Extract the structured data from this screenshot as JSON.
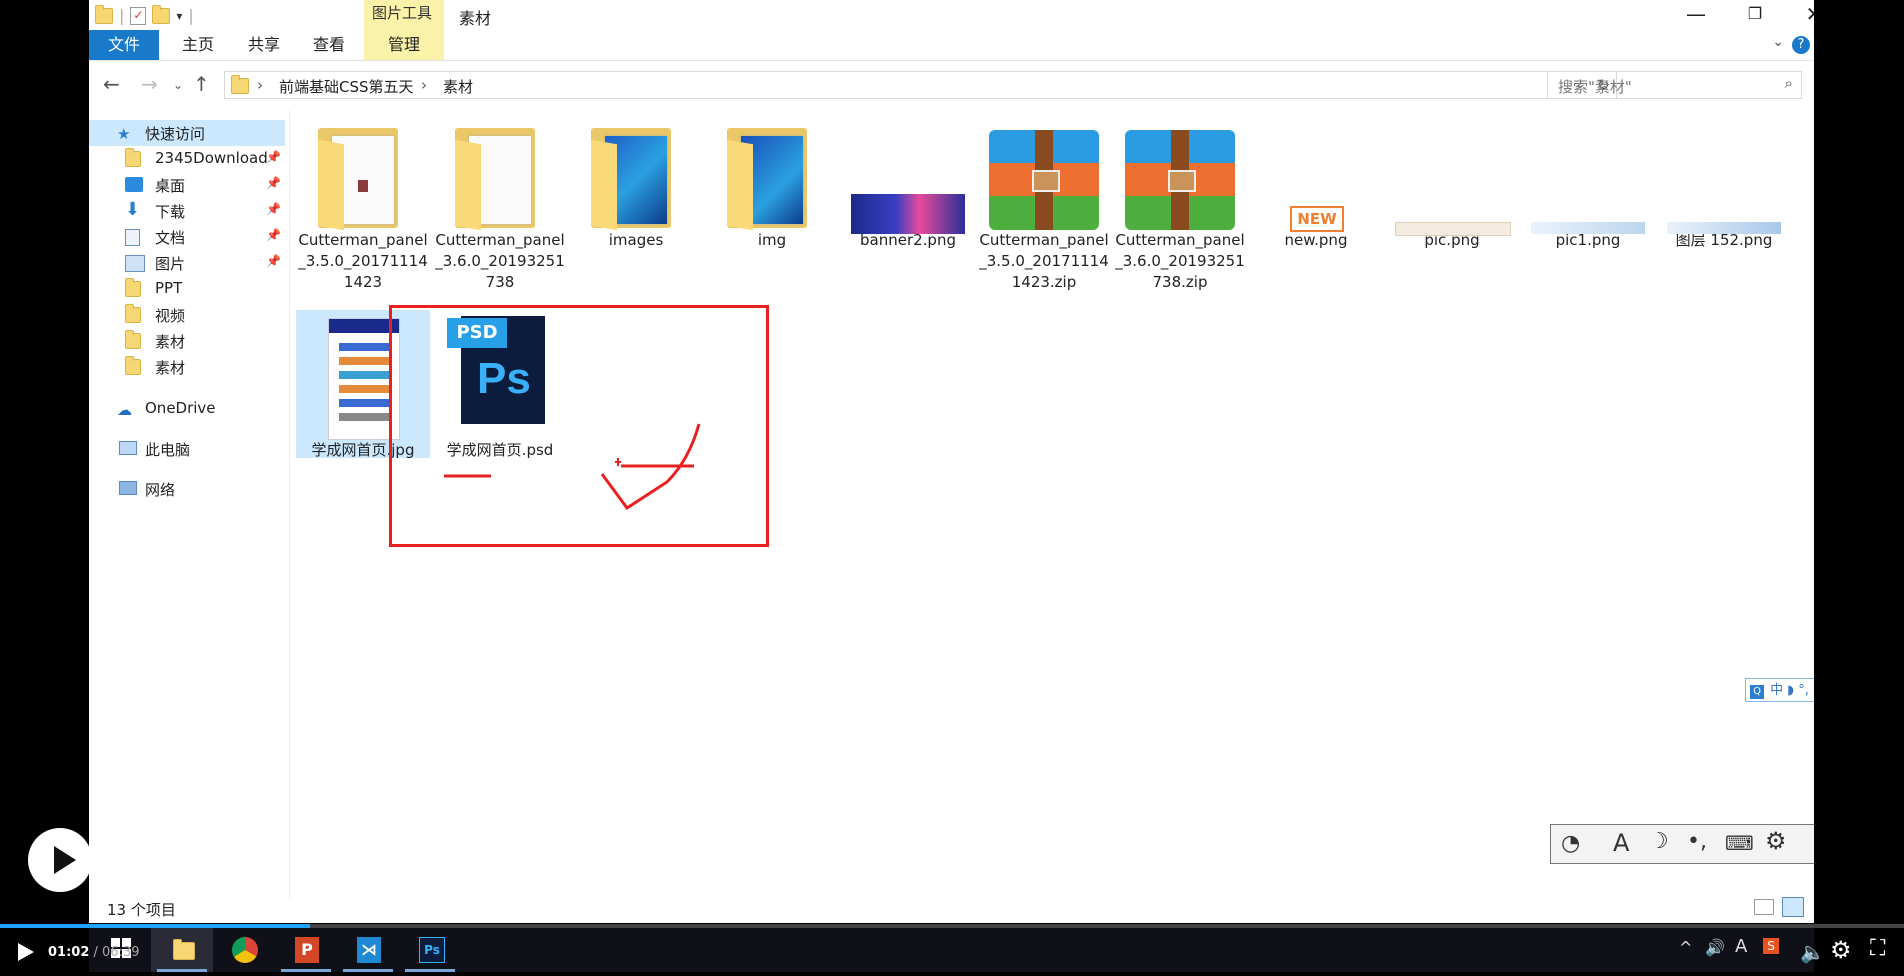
{
  "window": {
    "title": "素材",
    "contextual_tab_group": "图片工具",
    "controls": {
      "minimize": "—",
      "restore": "❐",
      "close": "✕"
    }
  },
  "ribbon": {
    "tabs": [
      "文件",
      "主页",
      "共享",
      "查看",
      "管理"
    ],
    "help": "?"
  },
  "address": {
    "crumbs": [
      "前端基础CSS第五天",
      "素材"
    ],
    "search_placeholder": "搜索\"素材\""
  },
  "sidebar": {
    "items": [
      {
        "label": "快速访问",
        "icon": "star-icon"
      },
      {
        "label": "2345Download",
        "icon": "folder-icon",
        "pinned": true
      },
      {
        "label": "桌面",
        "icon": "desktop-icon",
        "pinned": true
      },
      {
        "label": "下载",
        "icon": "download-icon",
        "pinned": true
      },
      {
        "label": "文档",
        "icon": "document-icon",
        "pinned": true
      },
      {
        "label": "图片",
        "icon": "pictures-icon",
        "pinned": true
      },
      {
        "label": "PPT",
        "icon": "folder-icon"
      },
      {
        "label": "视频",
        "icon": "folder-icon"
      },
      {
        "label": "素材",
        "icon": "folder-icon"
      },
      {
        "label": "素材",
        "icon": "folder-icon"
      },
      {
        "label": "OneDrive",
        "icon": "cloud-icon"
      },
      {
        "label": "此电脑",
        "icon": "computer-icon"
      },
      {
        "label": "网络",
        "icon": "network-icon"
      }
    ]
  },
  "files": [
    {
      "name": "Cutterman_panel_3.5.0_201711141423",
      "type": "folder"
    },
    {
      "name": "Cutterman_panel_3.6.0_20193251738",
      "type": "folder"
    },
    {
      "name": "images",
      "type": "folder"
    },
    {
      "name": "img",
      "type": "folder"
    },
    {
      "name": "banner2.png",
      "type": "png"
    },
    {
      "name": "Cutterman_panel_3.5.0_201711141423.zip",
      "type": "zip"
    },
    {
      "name": "Cutterman_panel_3.6.0_20193251738.zip",
      "type": "zip"
    },
    {
      "name": "new.png",
      "type": "png"
    },
    {
      "name": "pic.png",
      "type": "png"
    },
    {
      "name": "pic1.png",
      "type": "png"
    },
    {
      "name": "图层 152.png",
      "type": "png"
    },
    {
      "name": "学成网首页.jpg",
      "type": "jpg"
    },
    {
      "name": "学成网首页.psd",
      "type": "psd"
    }
  ],
  "thumb_text": {
    "new": "NEW",
    "psd": "PSD",
    "ps": "Ps"
  },
  "status": {
    "count": "13 个项目"
  },
  "ime": {
    "text": "中 ◗ °, ▦ ⁂ ✎"
  },
  "player": {
    "current": "01:02",
    "total": " / 06:39"
  },
  "colors": {
    "accent": "#1979ca",
    "annotation": "#e82020",
    "selection": "#cce8ff"
  }
}
